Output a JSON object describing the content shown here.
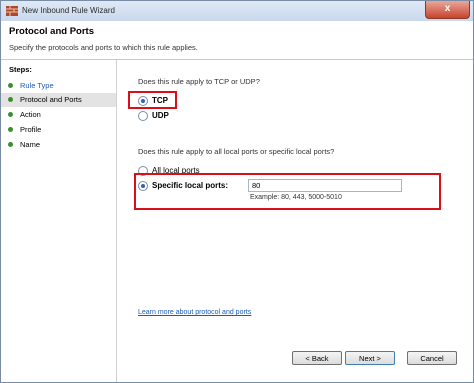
{
  "window": {
    "title": "New Inbound Rule Wizard",
    "close_glyph": "x",
    "icon": "firewall-icon"
  },
  "header": {
    "title": "Protocol and Ports",
    "subtitle": "Specify the protocols and ports to which this rule applies."
  },
  "steps": {
    "title": "Steps:",
    "items": [
      {
        "label": "Rule Type"
      },
      {
        "label": "Protocol and Ports"
      },
      {
        "label": "Action"
      },
      {
        "label": "Profile"
      },
      {
        "label": "Name"
      }
    ]
  },
  "protocol": {
    "question": "Does this rule apply to TCP or UDP?",
    "tcp_label": "TCP",
    "udp_label": "UDP",
    "selected": "TCP"
  },
  "ports": {
    "question": "Does this rule apply to all local ports or specific local ports?",
    "all_label": "All local ports",
    "specific_label": "Specific local ports:",
    "selected": "Specific local ports",
    "value": "80",
    "example": "Example: 80, 443, 5000-5010"
  },
  "learn_more": "Learn more about protocol and ports",
  "buttons": {
    "back": "< Back",
    "next": "Next >",
    "cancel": "Cancel"
  },
  "colors": {
    "highlight": "#d8101a",
    "link": "#1c5bb8",
    "step_dot": "#3a8f2f"
  }
}
